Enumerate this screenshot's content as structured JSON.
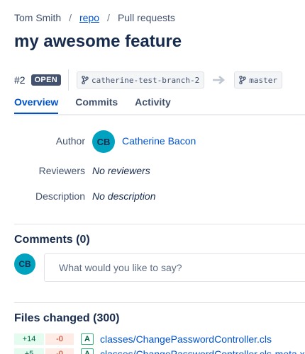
{
  "breadcrumb": {
    "owner": "Tom Smith",
    "repo": "repo",
    "page": "Pull requests",
    "separator": "/"
  },
  "pr": {
    "title": "my awesome feature",
    "number": "#2",
    "status": "OPEN",
    "source_branch": "catherine-test-branch-2",
    "target_branch": "master"
  },
  "tabs": [
    {
      "label": "Overview",
      "active": true
    },
    {
      "label": "Commits",
      "active": false
    },
    {
      "label": "Activity",
      "active": false
    }
  ],
  "overview": {
    "author_label": "Author",
    "author_initials": "CB",
    "author_name": "Catherine Bacon",
    "reviewers_label": "Reviewers",
    "reviewers_value": "No reviewers",
    "description_label": "Description",
    "description_value": "No description"
  },
  "comments": {
    "heading": "Comments (0)",
    "avatar_initials": "CB",
    "placeholder": "What would you like to say?"
  },
  "files": {
    "heading": "Files changed (300)",
    "items": [
      {
        "additions": "+14",
        "deletions": "-0",
        "type": "A",
        "name": "classes/ChangePasswordController.cls"
      },
      {
        "additions": "+5",
        "deletions": "-0",
        "type": "A",
        "name": "classes/ChangePasswordController.cls-meta.xml"
      }
    ]
  },
  "colors": {
    "accent": "#0052cc",
    "avatar": "#00a3bf",
    "badge": "#42526e",
    "added": "#e3fcef",
    "deleted": "#ffebe6"
  },
  "icons": {
    "branch": "git-branch-icon",
    "arrow": "arrow-right-icon"
  }
}
